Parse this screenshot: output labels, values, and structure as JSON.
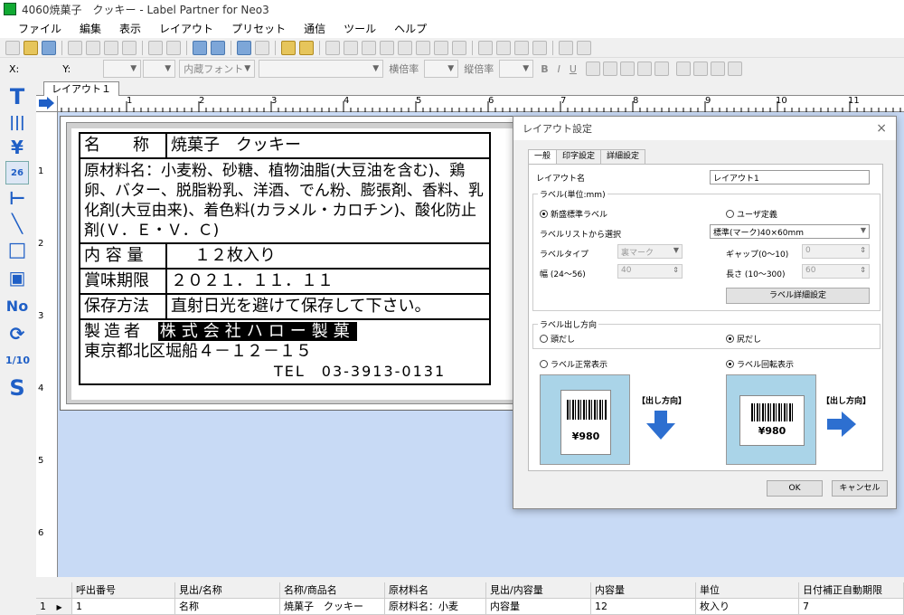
{
  "window": {
    "title": "4060焼菓子　クッキー - Label Partner for Neo3"
  },
  "menu": [
    "ファイル",
    "編集",
    "表示",
    "レイアウト",
    "プリセット",
    "通信",
    "ツール",
    "ヘルプ"
  ],
  "toolbar2": {
    "x_label": "X:",
    "y_label": "Y:",
    "font_value": "内蔵フォント",
    "horiz_label": "横倍率",
    "vert_label": "縦倍率",
    "bold": "B",
    "italic": "I",
    "underline": "U"
  },
  "tab": {
    "label": "レイアウト１"
  },
  "left_tools": [
    "T",
    "|||",
    "¥",
    "26",
    "⊢",
    "╲",
    "□",
    "▣",
    "No",
    "⟳",
    "1/10",
    "S"
  ],
  "ruler": {
    "h": [
      "1",
      "2",
      "3",
      "4",
      "5",
      "6",
      "7",
      "8",
      "9",
      "10",
      "11"
    ],
    "v": [
      "1",
      "2",
      "3",
      "4",
      "5",
      "6"
    ]
  },
  "label": {
    "name_key": "名　　称",
    "name_val": "焼菓子　クッキー",
    "ingredients": "原材料名：小麦粉、砂糖、植物油脂(大豆油を含む)、鶏卵、バター、脱脂粉乳、洋酒、でん粉、膨張剤、香料、乳化剤(大豆由来)、着色料(カラメル・カロチン)、酸化防止剤(Ｖ．Ｅ・Ｖ．Ｃ)",
    "qty_key": "内 容 量",
    "qty_val": "１２枚入り",
    "exp_key": "賞味期限",
    "exp_val": "２０２１．１１．１１",
    "store_key": "保存方法",
    "store_val": "直射日光を避けて保存して下さい。",
    "mfr_key": "製造者",
    "mfr_name": "株式会社ハロー製菓",
    "address": "東京都北区堀船４－１２－１５",
    "tel": "TEL　03-3913-0131"
  },
  "dialog": {
    "title": "レイアウト設定",
    "close": "×",
    "tabs": [
      "一般",
      "印字設定",
      "詳細設定"
    ],
    "layout_name_label": "レイアウト名",
    "layout_name_value": "レイアウト1",
    "label_group": "ラベル(単位:mm)",
    "radio_standard": "新盛標準ラベル",
    "radio_user": "ユーザ定義",
    "select_from_list": "ラベルリストから選択",
    "list_value": "標準(マーク)40×60mm",
    "label_type": "ラベルタイプ",
    "label_type_value": "裏マーク",
    "gap_label": "ギャップ(0〜10)",
    "gap_value": "0",
    "width_label": "幅 (24〜56)",
    "width_value": "40",
    "length_label": "長さ (10〜300)",
    "length_value": "60",
    "detail_btn": "ラベル詳細設定",
    "output_group": "ラベル出し方向",
    "head_out": "頭だし",
    "tail_out": "尻だし",
    "normal_display": "ラベル正常表示",
    "rotate_display": "ラベル回転表示",
    "direction_label": "【出し方向】",
    "price": "¥980",
    "ok": "OK",
    "cancel": "キャンセル"
  },
  "grid": {
    "headers": [
      "呼出番号",
      "見出/名称",
      "名称/商品名",
      "原材料名",
      "見出/内容量",
      "内容量",
      "単位",
      "日付補正自動期限"
    ],
    "row": [
      "1",
      "1",
      "名称",
      "焼菓子　クッキー",
      "原材料名：小麦",
      "内容量",
      "12",
      "枚入り",
      "7"
    ]
  }
}
